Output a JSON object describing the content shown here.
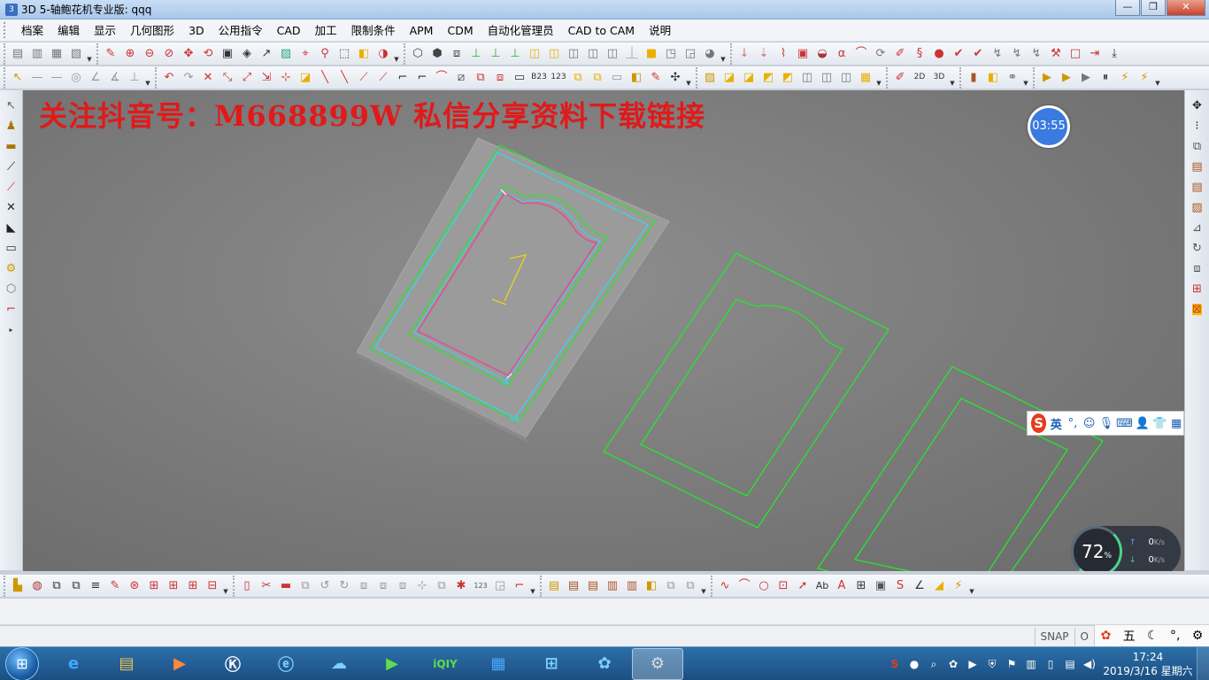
{
  "window": {
    "title": "3D 5-轴鲍花机专业版: qqq",
    "minimize": "—",
    "maximize": "❐",
    "close": "✕"
  },
  "menu": [
    "档案",
    "编辑",
    "显示",
    "几何图形",
    "3D",
    "公用指令",
    "CAD",
    "加工",
    "限制条件",
    "APM",
    "CDM",
    "自动化管理员",
    "CAD to CAM",
    "说明"
  ],
  "viewport": {
    "watermark": "关注抖音号：M668899W   私信分享资料下载链接",
    "timer": "03:55",
    "part_label": "1"
  },
  "ime": {
    "logo": "S",
    "mode": "英",
    "icons": [
      "punct-icon",
      "emoji-icon",
      "mic-icon",
      "keyboard-icon",
      "user-icon",
      "shirt-icon",
      "grid-icon"
    ]
  },
  "netmon": {
    "percent": "72",
    "percent_unit": "%",
    "upload": "0",
    "download": "0",
    "unit": "K/s"
  },
  "statusbar": {
    "snap": "SNAP",
    "ortho": "O"
  },
  "taskbar": {
    "clock_time": "17:24",
    "clock_date": "2019/3/16 星期六"
  },
  "colors": {
    "watermark": "#e01a1a",
    "geometry_green": "#27e62b",
    "toolpath_cyan": "#37d7e8",
    "contour_pink": "#e0508f",
    "label_yellow": "#e8d21f",
    "stock_gray": "#9a9a9a"
  }
}
